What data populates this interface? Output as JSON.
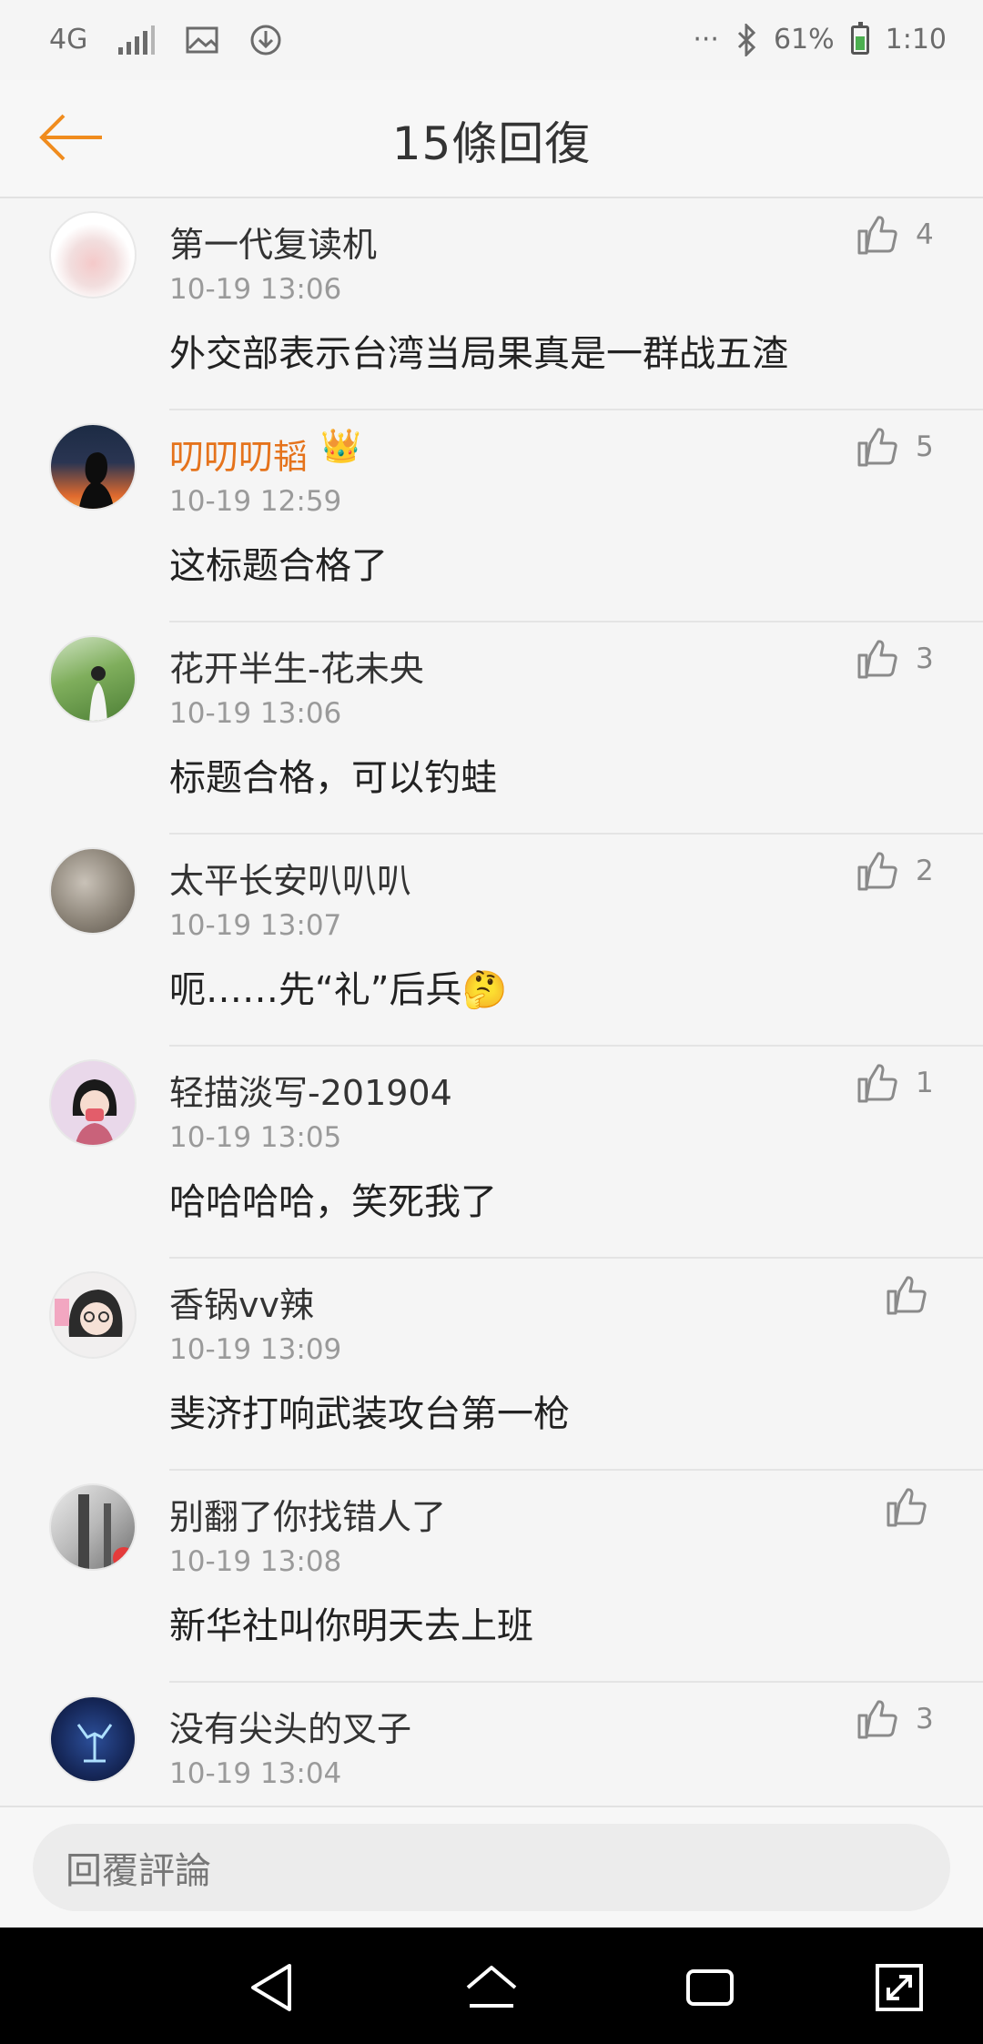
{
  "status_bar": {
    "network": "4G",
    "dots": "···",
    "battery": "61%",
    "time": "1:10"
  },
  "header": {
    "title": "15條回復"
  },
  "comments": [
    {
      "username": "第一代复读机",
      "time": "10-19 13:06",
      "text": "外交部表示台湾当局果真是一群战五渣",
      "likes": "4"
    },
    {
      "username": "叨叨叨韬",
      "time": "10-19 12:59",
      "text": "这标题合格了",
      "likes": "5"
    },
    {
      "username": "花开半生-花未央",
      "time": "10-19 13:06",
      "text": "标题合格，可以钓蛙",
      "likes": "3"
    },
    {
      "username": "太平长安叭叭叭",
      "time": "10-19 13:07",
      "text": "呃……先“礼”后兵",
      "likes": "2"
    },
    {
      "username": "轻描淡写-201904",
      "time": "10-19 13:05",
      "text": "哈哈哈哈，笑死我了",
      "likes": "1"
    },
    {
      "username": "香锅vv辣",
      "time": "10-19 13:09",
      "text": "斐济打响武装攻台第一枪",
      "likes": ""
    },
    {
      "username": "别翻了你找错人了",
      "time": "10-19 13:08",
      "text": "新华社叫你明天去上班",
      "likes": ""
    },
    {
      "username": "没有尖头的叉子",
      "time": "10-19 13:04",
      "text": "",
      "likes": "3"
    }
  ],
  "reply": {
    "placeholder": "回覆評論"
  },
  "colors": {
    "accent": "#f08c1e",
    "vip_name": "#e5731c",
    "background": "#f5f5f5"
  },
  "icons": {
    "back": "arrow-left-icon",
    "like": "thumbs-up-icon",
    "nav_back": "triangle-back-icon",
    "nav_home": "home-icon",
    "nav_recent": "square-icon",
    "nav_resize": "resize-icon"
  }
}
